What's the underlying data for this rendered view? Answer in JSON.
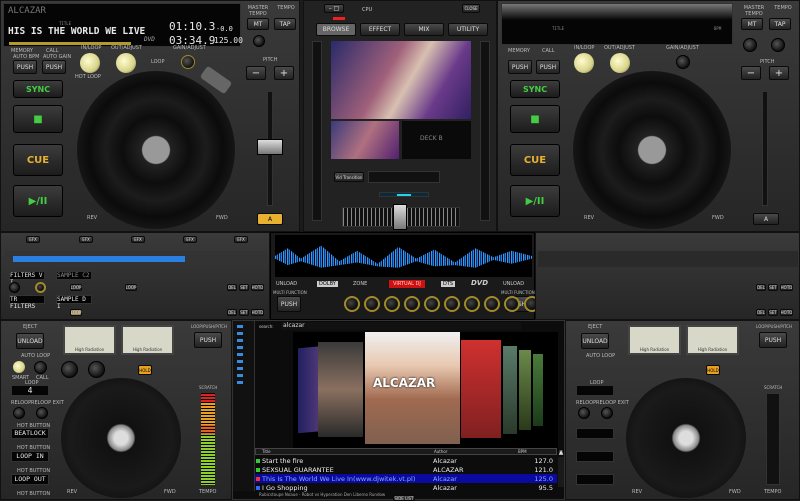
{
  "deck_a": {
    "artist": "ALCAZAR",
    "title": "HIS IS THE WORLD WE LIVE",
    "elapsed": "01:10.3",
    "remain": "03:34.9",
    "pitch": "-0.0",
    "bpm": "125.00",
    "label_title": "TITLE",
    "label_bpm": "BPM",
    "master_tempo": "MASTER TEMPO",
    "tempo": "TEMPO",
    "mt": "MT",
    "tap": "TAP",
    "memory": "MEMORY",
    "call": "CALL",
    "auto_bpm": "AUTO BPM",
    "auto_gain": "AUTO GAIN",
    "push": "PUSH",
    "in_loop": "IN/LOOP",
    "out_adjust": "OUT/ADJUST",
    "gain_adjust": "GAIN/ADJUST",
    "hot_loop": "HOT LOOP",
    "loop": "LOOP",
    "pitch_label": "PITCH",
    "minus": "−",
    "plus": "+",
    "sync": "SYNC",
    "cue": "CUE",
    "play_pause": "▶/II",
    "rev": "REV",
    "fwd": "FWD",
    "deck_letter": "A"
  },
  "deck_b": {
    "label_title": "TITLE",
    "label_bpm": "BPM",
    "deck_letter": "A"
  },
  "center": {
    "cpu": "CPU",
    "close": "CLOSE",
    "tabs": [
      "BROWSE",
      "EFFECT",
      "MIX",
      "UTILITY"
    ],
    "deck_b_label": "DECK B",
    "vid_transition": "Vid Transition"
  },
  "sampler": {
    "fx": [
      "EFX",
      "EFX",
      "EFX",
      "EFX",
      "EFX"
    ],
    "filters_v": "FILTERS V I",
    "tr_filters": "TR FILTERS",
    "sample_c": "SAMPLE C2",
    "sample_d": "SAMPLE D I",
    "loop": "LOOP",
    "del": "DEL",
    "set": "SET",
    "hotd": "HOTD"
  },
  "mixer": {
    "unload_left": "UNLOAD",
    "unload_right": "UNLOAD",
    "logos": [
      "DOLBY",
      "ZONE",
      "VIRTUAL DJ",
      "DTS",
      "DVD"
    ],
    "multi_function": "MULTI FUNCTION",
    "push": "PUSH"
  },
  "bottom_deck": {
    "eject": "EJECT",
    "unload": "UNLOAD",
    "auto_loop": "AUTO LOOP",
    "smart": "SMART",
    "call": "CALL",
    "loop": "LOOP",
    "loop_value": "4",
    "reloop": "RELOOP",
    "reloop_exit": "RELOOP EXIT",
    "hot_button": "HOT BUTTON",
    "beatlock": "BEATLOCK",
    "loop_in": "LOOP IN",
    "loop_out": "LOOP OUT",
    "loop_push": "LOOP/PUSH/PITCH",
    "push": "PUSH",
    "vu_label": "High Radiation",
    "scratch": "SCRATCH",
    "tempo": "TEMPO",
    "rev": "REV",
    "fwd": "FWD",
    "hold": "HOLD"
  },
  "browser": {
    "search_label": "search:",
    "search_value": "alcazar",
    "cover_text": "ALCAZAR",
    "columns": [
      "Title",
      "Author",
      "BPM"
    ],
    "rows": [
      {
        "title": "Start the fire",
        "author": "Alcazar",
        "bpm": "127.0",
        "color": "#3c3"
      },
      {
        "title": "SEXSUAL GUARANTEE",
        "author": "ALCAZAR",
        "bpm": "121.0",
        "color": "#3c3"
      },
      {
        "title": "This Is The World We Live In(www.djwitek.vt.pl)",
        "author": "Alcazar",
        "bpm": "125.0",
        "color": "#e33"
      },
      {
        "title": "I Go Shopping",
        "author": "Alcazar",
        "bpm": "95.5",
        "color": "#36f"
      }
    ],
    "status": "Rubicstoupe Noaue  -  Robot vs Hyperation  Den Liberno  Rundow",
    "side_list": "SIDE LIST"
  },
  "colors": {
    "accent": "#2a7fe0",
    "selected": "#0a0aa0"
  }
}
